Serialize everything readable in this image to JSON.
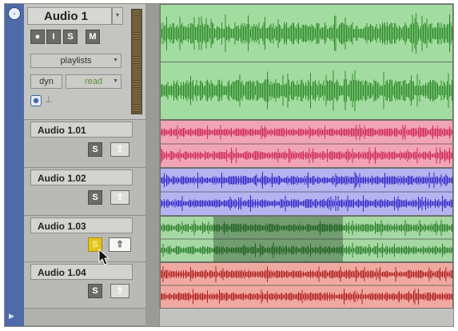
{
  "tracks": [
    {
      "name": "Audio 1",
      "buttons": [
        "●",
        "I",
        "S",
        "M"
      ],
      "playlist_label": "playlists",
      "automation_label": "dyn",
      "automation_mode": "read",
      "lane_color": "#a3dca0",
      "wave_color": "#2f8b2a"
    },
    {
      "name": "Audio 1.01",
      "solo": "S",
      "lane_color": "#f1a5b4",
      "wave_color": "#d0265a"
    },
    {
      "name": "Audio 1.02",
      "solo": "S",
      "lane_color": "#b5b3f0",
      "wave_color": "#3026c8"
    },
    {
      "name": "Audio 1.03",
      "solo": "S",
      "solo_state": "on",
      "lane_color": "#a5d8a3",
      "wave_color": "#2a7e2a"
    },
    {
      "name": "Audio 1.04",
      "solo": "S",
      "lane_color": "#f0a9a0",
      "wave_color": "#b02020"
    }
  ],
  "icons": {
    "collapse": "circle-icon",
    "expand": "triangle-right-icon",
    "up_arrow": "up-arrow-icon",
    "dropdown": "dropdown-triangle-icon"
  }
}
